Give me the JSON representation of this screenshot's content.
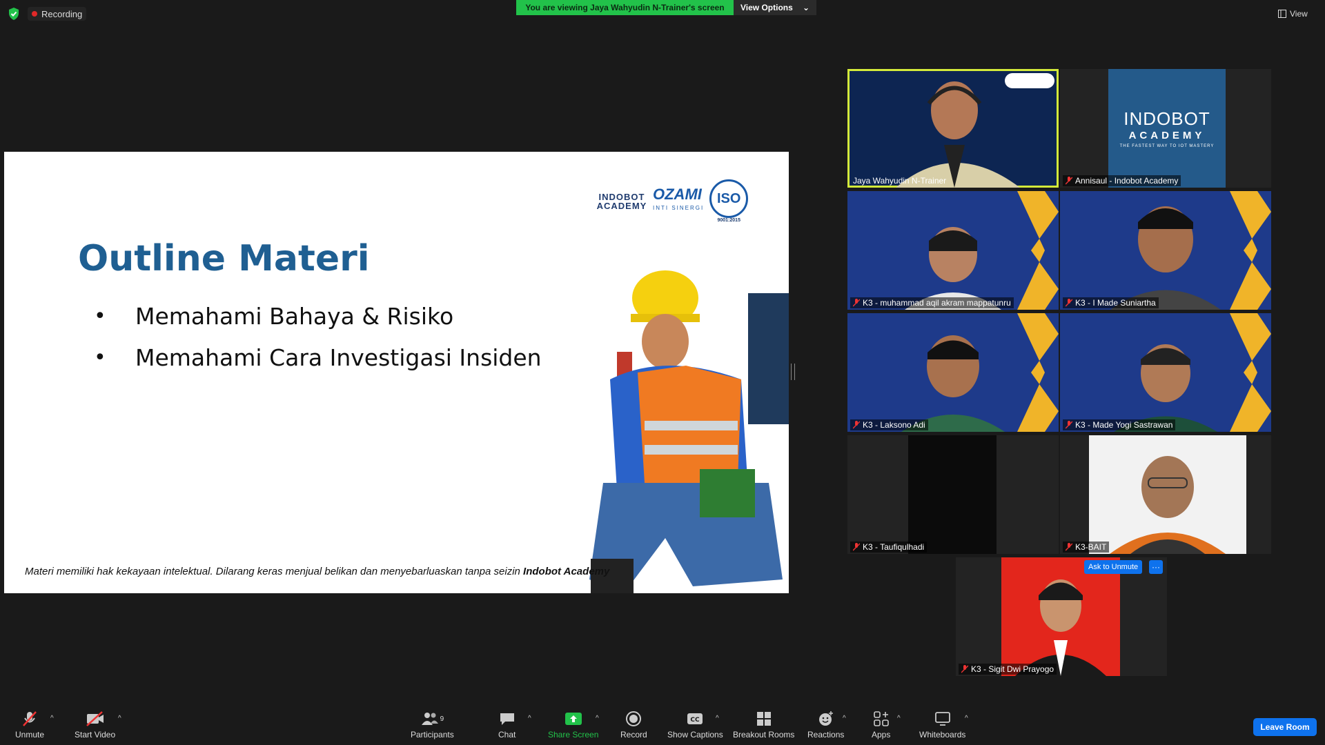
{
  "top_bar": {
    "recording_label": "Recording",
    "viewing_label": "You are viewing Jaya Wahyudin N-Trainer's screen",
    "view_options_label": "View Options",
    "view_label": "View"
  },
  "slide": {
    "title": "Outline Materi",
    "bullets": [
      "Memahami Bahaya & Risiko",
      "Memahami Cara Investigasi Insiden"
    ],
    "footer_text": "Materi memiliki hak kekayaan intelektual. Dilarang keras menjual belikan dan menyebarluaskan tanpa seizin ",
    "footer_brand": "Indobot Academy",
    "logo_indobot": "INDOBOT ACADEMY",
    "logo_ozami": "OZAMI",
    "logo_ozami_sub": "INTI SINERGI",
    "logo_iso": "ISO",
    "logo_iso_sub": "9001:2015"
  },
  "participants_tiles": [
    {
      "name": "Jaya Wahyudin N-Trainer",
      "muted": false
    },
    {
      "name": "Annisaul - Indobot Academy",
      "muted": true
    },
    {
      "name": "K3 - muhammad aqil akram mappatunru",
      "muted": true
    },
    {
      "name": "K3 - I Made Suniartha",
      "muted": true
    },
    {
      "name": "K3 - Laksono Adi",
      "muted": true
    },
    {
      "name": "K3 - Made Yogi Sastrawan",
      "muted": true
    },
    {
      "name": "K3 - Taufiqulhadi",
      "muted": true
    },
    {
      "name": "K3-BAIT",
      "muted": true
    },
    {
      "name": "K3 - Sigit Dwi Prayogo",
      "muted": true
    }
  ],
  "annisaul_tile": {
    "brand": "INDOBOT",
    "brand2": "ACADEMY",
    "tagline": "THE FASTEST WAY TO IOT MASTERY"
  },
  "ask_to_unmute_label": "Ask to Unmute",
  "more_label": "···",
  "toolbar": {
    "unmute": "Unmute",
    "start_video": "Start Video",
    "participants": "Participants",
    "participants_count": "9",
    "chat": "Chat",
    "share_screen": "Share Screen",
    "record": "Record",
    "show_captions": "Show Captions",
    "breakout_rooms": "Breakout Rooms",
    "reactions": "Reactions",
    "apps": "Apps",
    "whiteboards": "Whiteboards",
    "leave_room": "Leave Room"
  },
  "colors": {
    "accent_green": "#22c24a",
    "accent_blue": "#0e72ed",
    "active_speaker": "#d4ea3a",
    "slide_title": "#1f5f92"
  }
}
